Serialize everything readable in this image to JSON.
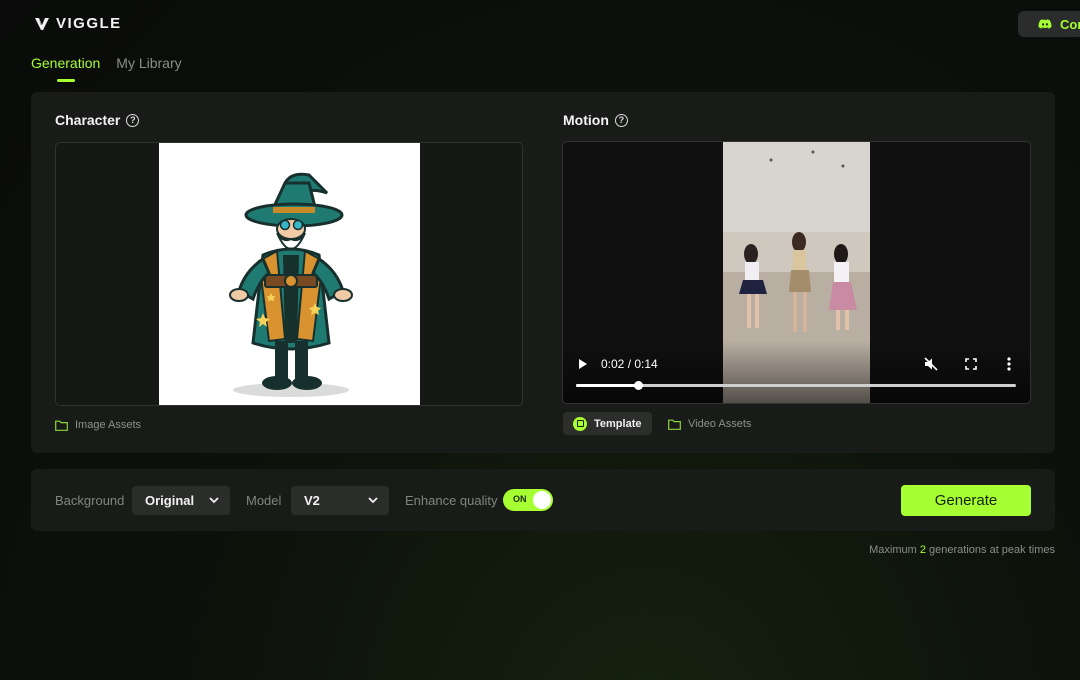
{
  "brand": {
    "name": "VIGGLE",
    "accent": "#a6ff32"
  },
  "header": {
    "discord_label": "Cor"
  },
  "tabs": [
    {
      "label": "Generation",
      "active": true
    },
    {
      "label": "My Library",
      "active": false
    }
  ],
  "character": {
    "title": "Character",
    "assets_label": "Image Assets"
  },
  "motion": {
    "title": "Motion",
    "time_display": "0:02 / 0:14",
    "progress": 0.14,
    "template_label": "Template",
    "assets_label": "Video Assets"
  },
  "controls": {
    "background_label": "Background",
    "background_value": "Original",
    "model_label": "Model",
    "model_value": "V2",
    "enhance_label": "Enhance quality",
    "enhance_toggle": "ON",
    "generate_label": "Generate"
  },
  "footnote": {
    "prefix": "Maximum",
    "count": "2",
    "suffix": "generations at peak times"
  }
}
